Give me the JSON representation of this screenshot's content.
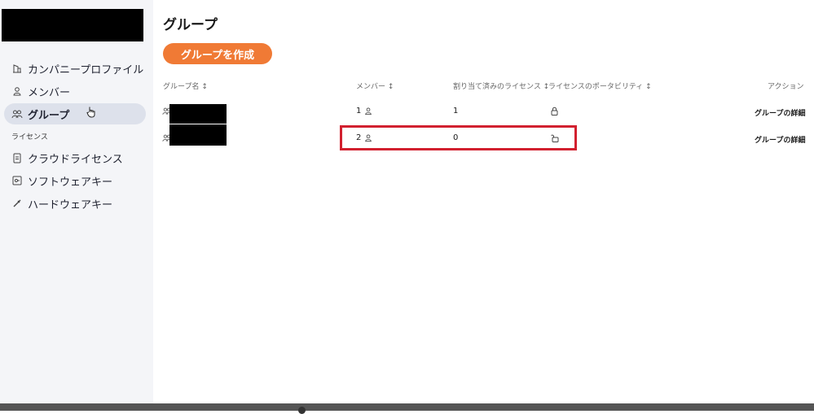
{
  "sidebar": {
    "items": [
      {
        "label": "カンパニープロファイル",
        "icon": "building-icon"
      },
      {
        "label": "メンバー",
        "icon": "person-icon"
      },
      {
        "label": "グループ",
        "icon": "group-icon",
        "active": true
      }
    ],
    "license_section": "ライセンス",
    "license_items": [
      {
        "label": "クラウドライセンス",
        "icon": "cloud-license-icon"
      },
      {
        "label": "ソフトウェアキー",
        "icon": "software-key-icon"
      },
      {
        "label": "ハードウェアキー",
        "icon": "hardware-key-icon"
      }
    ]
  },
  "main": {
    "title": "グループ",
    "create_button": "グループを作成",
    "table": {
      "headers": [
        "グループ名 ↕",
        "メンバー ↕",
        "割り当て済みのライセンス ↕",
        "ライセンスのポータビリティ ↕",
        "アクション"
      ],
      "rows": [
        {
          "members": "1",
          "assigned": "1",
          "portability_icon": "lock-icon",
          "action": "グループの詳細"
        },
        {
          "members": "2",
          "assigned": "0",
          "portability_icon": "unlock-icon",
          "action": "グループの詳細"
        }
      ]
    }
  },
  "colors": {
    "accent": "#f07a35",
    "highlight": "#d2202f",
    "sidebar_bg": "#f4f5f8"
  }
}
